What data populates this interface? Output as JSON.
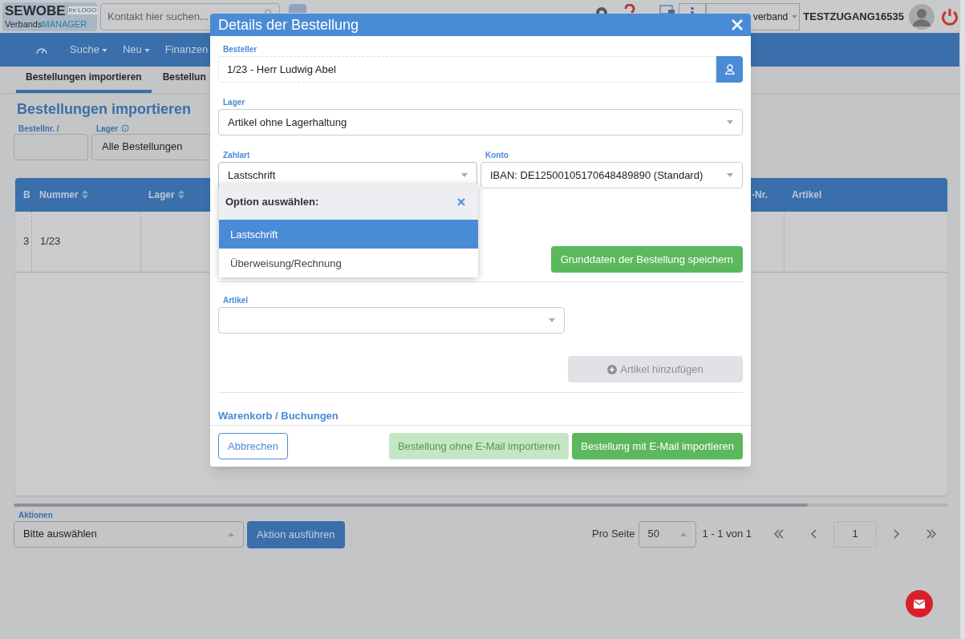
{
  "logo": {
    "brand": "SEWOBE",
    "sub_a": "Verbands",
    "sub_b": "MANAGER",
    "badge": "Ihr LOGO"
  },
  "app_bar": {
    "search_placeholder": "Kontakt hier suchen...",
    "association": "verband",
    "user": "TESTZUGANG16535"
  },
  "nav": [
    {
      "label": "Suche"
    },
    {
      "label": "Neu"
    },
    {
      "label": "Finanzen"
    }
  ],
  "tabs": [
    {
      "label": "Bestellungen importieren",
      "selected": true
    },
    {
      "label": "Bestellun",
      "selected": false
    }
  ],
  "page_title": "Bestellungen importieren",
  "filters": [
    {
      "kind": "input",
      "label": "Bestellnr. /"
    },
    {
      "kind": "select",
      "label": "Lager",
      "info": true,
      "value": "Alle Bestellungen"
    }
  ],
  "table": {
    "columns": [
      {
        "label": "B",
        "sortable": false
      },
      {
        "label": "Nummer",
        "sortable": true
      },
      {
        "label": "Lager",
        "sortable": true
      },
      {
        "label": "-Nr.",
        "sortable": false
      },
      {
        "label": "Artikel",
        "sortable": false
      }
    ],
    "rows": [
      [
        "3",
        "1/23"
      ]
    ]
  },
  "actions": {
    "label": "Aktionen",
    "value": "Bitte auswählen",
    "button": "Aktion ausführen"
  },
  "pagination": {
    "per_page_label": "Pro Seite",
    "per_page": "50",
    "range": "1 - 1 von 1",
    "page": "1"
  },
  "modal": {
    "title": "Details der Bestellung",
    "besteller": {
      "label": "Besteller",
      "value": "1/23 - Herr Ludwig Abel"
    },
    "lager": {
      "label": "Lager",
      "value": "Artikel ohne Lagerhaltung"
    },
    "zahlart": {
      "label": "Zahlart",
      "value": "Lastschrift",
      "expanded": true
    },
    "konto": {
      "label": "Konto",
      "value": "IBAN: DE12500105170648489890 (Standard)"
    },
    "dropdown": {
      "header": "Option auswählen:",
      "options": [
        {
          "label": "Lastschrift",
          "selected": true
        },
        {
          "label": "Überweisung/Rechnung",
          "selected": false
        }
      ]
    },
    "save_button": "Grunddaten der Bestellung speichern",
    "artikel": {
      "label": "Artikel"
    },
    "add_button": {
      "label": "Artikel hinzufügen",
      "disabled": true
    },
    "section_link": "Warenkorb / Buchungen",
    "cancel": "Abbrechen",
    "buttons": [
      {
        "label": "Bestellung ohne E-Mail importieren",
        "disabled": true
      },
      {
        "label": "Bestellung mit E-Mail importieren",
        "disabled": false
      }
    ]
  }
}
